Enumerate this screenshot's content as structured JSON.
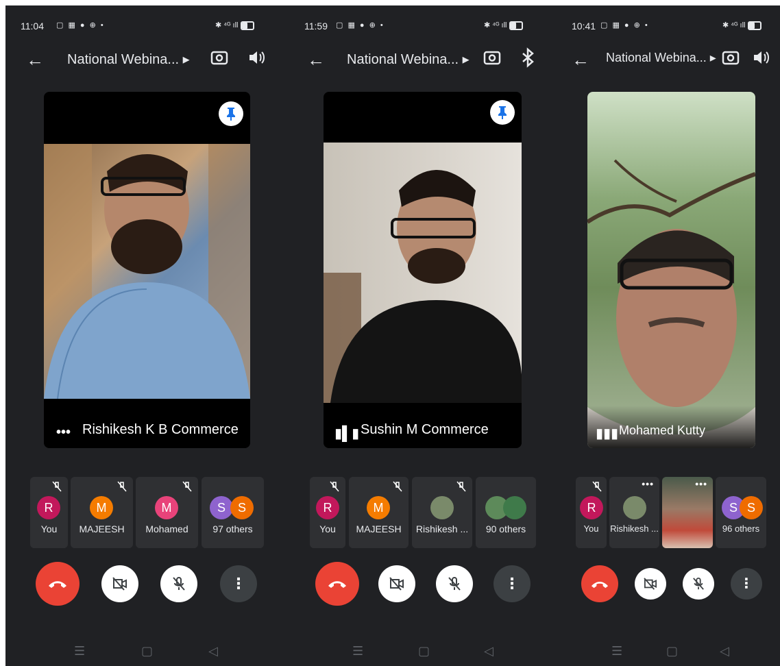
{
  "panels": [
    {
      "status_time": "11:04",
      "call_title": "National Webina...",
      "speaker_name": "Rishikesh K B Commerce",
      "participants": [
        {
          "label": "You",
          "initial": "R"
        },
        {
          "label": "MAJEESH",
          "initial": "M"
        },
        {
          "label": "Mohamed",
          "initial": "M"
        },
        {
          "label": "97 others",
          "initials": [
            "S",
            "S"
          ]
        }
      ]
    },
    {
      "status_time": "11:59",
      "call_title": "National Webina...",
      "speaker_name": "Sushin M Commerce",
      "participants": [
        {
          "label": "You",
          "initial": "R"
        },
        {
          "label": "MAJEESH",
          "initial": "M"
        },
        {
          "label": "Rishikesh ..."
        },
        {
          "label": "90 others"
        }
      ]
    },
    {
      "status_time": "10:41",
      "call_title": "National Webina...",
      "speaker_name": "Mohamed Kutty",
      "participants": [
        {
          "label": "You",
          "initial": "R"
        },
        {
          "label": "Rishikesh ..."
        },
        {
          "label": ""
        },
        {
          "label": "96 others",
          "initials": [
            "S",
            "S"
          ]
        }
      ]
    }
  ],
  "icons": {
    "back": "arrow-left-icon",
    "switch_camera": "camera-switch-icon",
    "speaker": "volume-icon",
    "bluetooth": "bluetooth-icon",
    "pin": "pin-icon",
    "end_call": "end-call-icon",
    "camera_off": "camera-off-icon",
    "mic_off": "mic-off-icon",
    "more": "more-vert-icon"
  },
  "colors": {
    "background": "#202124",
    "end_call": "#ea4335",
    "avatar_r": "#c2185b",
    "avatar_m_orange": "#f57c00",
    "avatar_m_pink": "#e8437a",
    "avatar_s_purple": "#8e63ce",
    "avatar_s_orange": "#ef6c00",
    "pin_blue": "#1a73e8"
  }
}
